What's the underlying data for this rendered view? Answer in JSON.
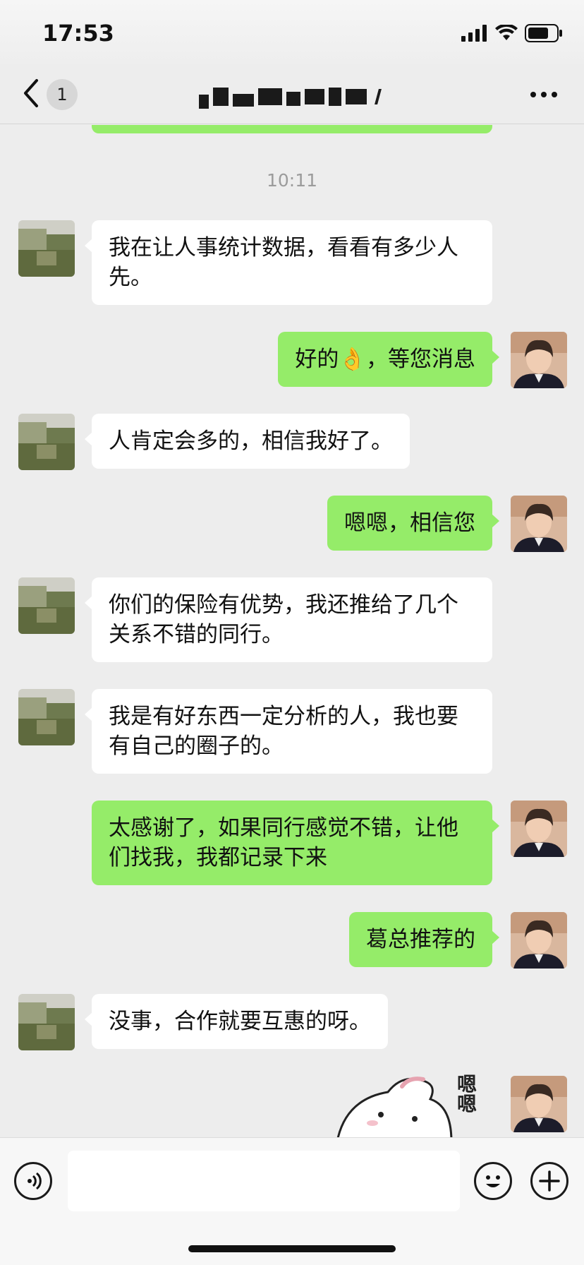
{
  "status_bar": {
    "time": "17:53"
  },
  "header": {
    "unread_count": "1"
  },
  "chat": {
    "timestamp": "10:11",
    "messages": [
      {
        "dir": "in",
        "text": "我在让人事统计数据，看看有多少人先。"
      },
      {
        "dir": "out",
        "text": "好的👌，等您消息"
      },
      {
        "dir": "in",
        "text": "人肯定会多的，相信我好了。"
      },
      {
        "dir": "out",
        "text": "嗯嗯，相信您"
      },
      {
        "dir": "in",
        "text": "你们的保险有优势，我还推给了几个关系不错的同行。"
      },
      {
        "dir": "in",
        "text": "我是有好东西一定分析的人，我也要有自己的圈子的。"
      },
      {
        "dir": "out",
        "text": "太感谢了，如果同行感觉不错，让他们找我，我都记录下来"
      },
      {
        "dir": "out",
        "text": "葛总推荐的"
      },
      {
        "dir": "in",
        "text": "没事，合作就要互惠的呀。"
      }
    ],
    "sticker_text": "嗯嗯"
  },
  "colors": {
    "sent_bubble": "#95ec69",
    "received_bubble": "#ffffff",
    "background": "#ededed"
  }
}
